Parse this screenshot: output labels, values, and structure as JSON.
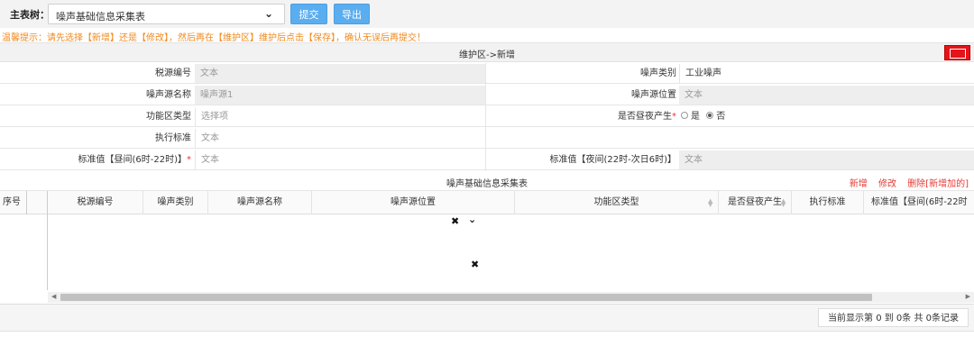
{
  "toolbar": {
    "main_table_label": "主表树：",
    "main_table_value": "噪声基础信息采集表",
    "submit_label": "提交",
    "export_label": "导出"
  },
  "tip": "温馨提示：请先选择【新增】还是【修改】，然后再在【维护区】维护后点击【保存】，确认无误后再提交！",
  "maint": {
    "title": "维护区->新增"
  },
  "form": {
    "tax_code_label": "税源编号",
    "tax_code_value": "文本",
    "noise_type_label": "噪声类别",
    "noise_type_value": "工业噪声",
    "source_name_label": "噪声源名称",
    "source_name_value": "噪声源1",
    "source_location_label": "噪声源位置",
    "source_location_value": "文本",
    "func_zone_label": "功能区类型",
    "func_zone_placeholder": "选择项",
    "day_night_label": "是否昼夜产生",
    "yes_label": "是",
    "no_label": "否",
    "exec_std_label": "执行标准",
    "exec_std_value": "文本",
    "std_day_label": "标准值【昼间(6时-22时)】",
    "std_day_value": "文本",
    "std_night_label": "标准值【夜间(22时-次日6时)】",
    "std_night_value": "文本",
    "required_mark": "*"
  },
  "table": {
    "title": "噪声基础信息采集表",
    "actions": [
      "新增",
      "修改",
      "删除[新增加的]"
    ],
    "columns": [
      "序号",
      "税源编号",
      "噪声类别",
      "噪声源名称",
      "噪声源位置",
      "功能区类型",
      "是否昼夜产生",
      "执行标准",
      "标准值【昼间(6时-22时"
    ],
    "pager_text": "当前显示第  0 到  0条  共  0条记录"
  },
  "colors": {
    "accent_button": "#5aaef0",
    "tip_text": "#f08a1e",
    "action_links": "#e53935",
    "save_icon": "#e4141b"
  }
}
